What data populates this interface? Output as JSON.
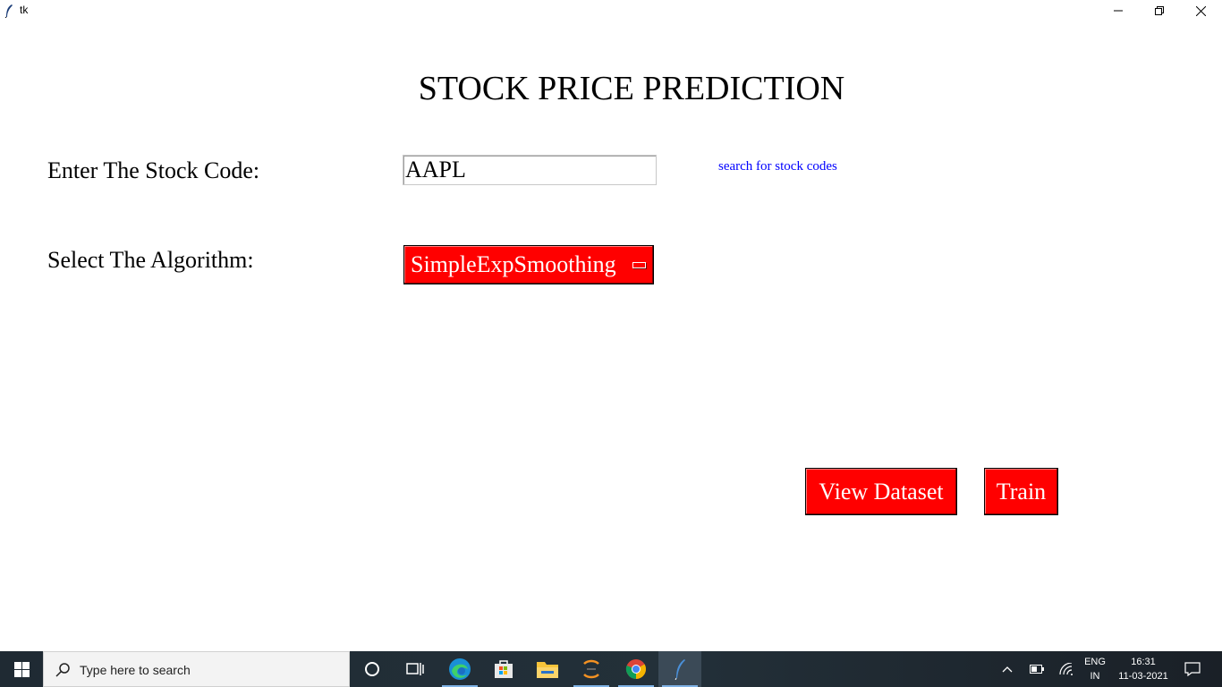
{
  "window": {
    "title": "tk"
  },
  "form": {
    "heading": "STOCK PRICE PREDICTION",
    "stock_code_label": "Enter The Stock Code:",
    "stock_code_value": "AAPL",
    "search_link_text": "search for stock codes",
    "algorithm_label": "Select The Algorithm:",
    "algorithm_selected": "SimpleExpSmoothing",
    "view_dataset_label": "View Dataset",
    "train_label": "Train"
  },
  "colors": {
    "button_bg": "#ff0000",
    "button_text": "#ffffff",
    "link": "#0000ff",
    "taskbar": "#1f2a33"
  },
  "taskbar": {
    "search_placeholder": "Type here to search",
    "pinned_icons": [
      "cortana-icon",
      "task-view-icon",
      "edge-icon",
      "store-icon",
      "file-explorer-icon",
      "sublime-icon",
      "chrome-icon",
      "tk-feather-icon"
    ],
    "language_line1": "ENG",
    "language_line2": "IN",
    "time": "16:31",
    "date": "11-03-2021"
  }
}
